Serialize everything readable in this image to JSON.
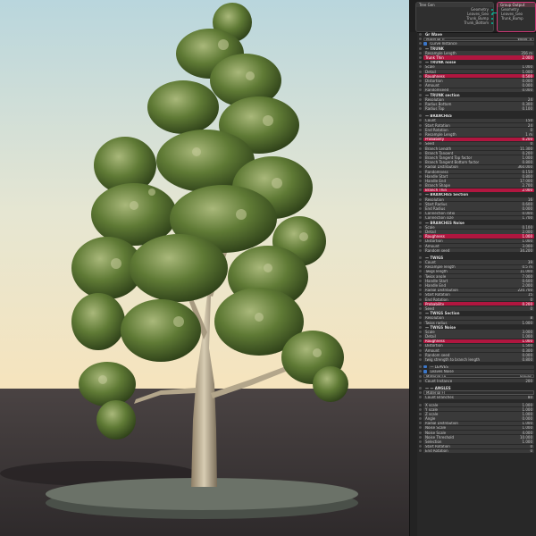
{
  "colors": {
    "accent": "#b0163f",
    "sky_top": "#bcd7dd",
    "sky_bottom": "#f4e6c5",
    "ground": "#3f3a39",
    "socket": "#00c0a0"
  },
  "node_editor": {
    "geometry_node": {
      "title": "Tree Gen",
      "rows": [
        "Geometry",
        "Leaves_Geo",
        "Trunk_Bump",
        "Trunk_Bottom"
      ]
    },
    "output_node": {
      "title": "Group Output",
      "rows": [
        "Geometry",
        "Leaves_Geo",
        "Trunk_Bump"
      ]
    }
  },
  "properties": [
    {
      "kind": "sec",
      "label": "Gr   Wave"
    },
    {
      "kind": "field",
      "label": "Material Tr",
      "value": "Wood_4"
    },
    {
      "kind": "check",
      "label": "Curve Instance"
    },
    {
      "kind": "sec",
      "label": "— TRUNK"
    },
    {
      "kind": "num",
      "label": "Resample Length",
      "value": "356 m"
    },
    {
      "kind": "hl",
      "label": "Trunk Thin",
      "value": "2.000"
    },
    {
      "kind": "sec",
      "label": "— TRUNK noise"
    },
    {
      "kind": "num",
      "label": "Scale",
      "value": "1.000"
    },
    {
      "kind": "num",
      "label": "Detail",
      "value": "1.000"
    },
    {
      "kind": "hl",
      "label": "Roughness",
      "value": "0.500"
    },
    {
      "kind": "num",
      "label": "Distortion",
      "value": "0.000"
    },
    {
      "kind": "num",
      "label": "Amount",
      "value": "0.000"
    },
    {
      "kind": "num",
      "label": "Randomseed",
      "value": "0.000"
    },
    {
      "kind": "sec",
      "label": "— TRUNK section"
    },
    {
      "kind": "num",
      "label": "Resolution",
      "value": "24"
    },
    {
      "kind": "num",
      "label": "Radius Bottom",
      "value": "0.300"
    },
    {
      "kind": "num",
      "label": "Radius Top",
      "value": "0.100"
    },
    {
      "kind": "gap"
    },
    {
      "kind": "sec",
      "label": "— BRANCHES"
    },
    {
      "kind": "num",
      "label": "Count",
      "value": "150"
    },
    {
      "kind": "num",
      "label": "Start Rotation",
      "value": "24"
    },
    {
      "kind": "num",
      "label": "End Rotation",
      "value": "0"
    },
    {
      "kind": "num",
      "label": "Resample Length",
      "value": "1 m"
    },
    {
      "kind": "hl",
      "label": "Probability",
      "value": "0.200"
    },
    {
      "kind": "num",
      "label": "Seed",
      "value": "0"
    },
    {
      "kind": "num",
      "label": "Branch Length",
      "value": "11.300"
    },
    {
      "kind": "num",
      "label": "Branch Tangent",
      "value": "0.200"
    },
    {
      "kind": "num",
      "label": "Branch Tangent Top factor",
      "value": "1.000"
    },
    {
      "kind": "num",
      "label": "Branch Tangent Bottom factor",
      "value": "0.800"
    },
    {
      "kind": "num",
      "label": "Radial Distribution",
      "value": "360.000"
    },
    {
      "kind": "num",
      "label": "Randomness",
      "value": "0.150"
    },
    {
      "kind": "num",
      "label": "Handle Start",
      "value": "0.800"
    },
    {
      "kind": "num",
      "label": "Handle End",
      "value": "17.000"
    },
    {
      "kind": "num",
      "label": "Branch Shape",
      "value": "2.700"
    },
    {
      "kind": "hl",
      "label": "Branch Thin",
      "value": "2.000"
    },
    {
      "kind": "sec",
      "label": "— BRANCHES Section"
    },
    {
      "kind": "num",
      "label": "Resolution",
      "value": "16"
    },
    {
      "kind": "num",
      "label": "Start Radius",
      "value": "0.600"
    },
    {
      "kind": "num",
      "label": "End Radius",
      "value": "0.000"
    },
    {
      "kind": "num",
      "label": "Connection ratio",
      "value": "0.000"
    },
    {
      "kind": "num",
      "label": "Connection size",
      "value": "1.700"
    },
    {
      "kind": "sec",
      "label": "— BRANCHES Noise"
    },
    {
      "kind": "num",
      "label": "Scale",
      "value": "0.100"
    },
    {
      "kind": "num",
      "label": "Detail",
      "value": "2.000"
    },
    {
      "kind": "hl",
      "label": "Roughness",
      "value": "1.000"
    },
    {
      "kind": "num",
      "label": "Distortion",
      "value": "1.000"
    },
    {
      "kind": "num",
      "label": "Amount",
      "value": "3.000"
    },
    {
      "kind": "num",
      "label": "Random seed",
      "value": "34.200"
    },
    {
      "kind": "gap"
    },
    {
      "kind": "sec",
      "label": "— TWIGS"
    },
    {
      "kind": "num",
      "label": "Count",
      "value": "39"
    },
    {
      "kind": "num",
      "label": "Resample length",
      "value": "0.5 m"
    },
    {
      "kind": "num",
      "label": "Twigs length",
      "value": "11.000"
    },
    {
      "kind": "num",
      "label": "Twigs angle",
      "value": "7.000"
    },
    {
      "kind": "num",
      "label": "Handle Start",
      "value": "0.600"
    },
    {
      "kind": "num",
      "label": "Handle End",
      "value": "2.000"
    },
    {
      "kind": "num",
      "label": "Radial Distribution",
      "value": "220.700"
    },
    {
      "kind": "num",
      "label": "Start Rotation",
      "value": "15"
    },
    {
      "kind": "num",
      "label": "End Rotation",
      "value": "0"
    },
    {
      "kind": "hl",
      "label": "Probability",
      "value": "0.200"
    },
    {
      "kind": "num",
      "label": "Seed",
      "value": "0"
    },
    {
      "kind": "sec",
      "label": "— TWIGS Section"
    },
    {
      "kind": "num",
      "label": "Resolution",
      "value": "8"
    },
    {
      "kind": "num",
      "label": "Twigs radius",
      "value": "1.000"
    },
    {
      "kind": "sec",
      "label": "— TWIGS Noise"
    },
    {
      "kind": "num",
      "label": "Scale",
      "value": "3.000"
    },
    {
      "kind": "num",
      "label": "Detail",
      "value": "1.000"
    },
    {
      "kind": "hl",
      "label": "Roughness",
      "value": "1.000"
    },
    {
      "kind": "num",
      "label": "Distortion",
      "value": "1.500"
    },
    {
      "kind": "num",
      "label": "Amount",
      "value": "0.300"
    },
    {
      "kind": "num",
      "label": "Random seed",
      "value": "0.000"
    },
    {
      "kind": "num",
      "label": "twig strength to branch length",
      "value": "0.800"
    },
    {
      "kind": "gap"
    },
    {
      "kind": "check",
      "label": "— LEAVES"
    },
    {
      "kind": "check",
      "label": "Leaves Noise"
    },
    {
      "kind": "field",
      "label": "Material Le",
      "value": "leaves"
    },
    {
      "kind": "num",
      "label": "Count Instance",
      "value": "200"
    },
    {
      "kind": "gap"
    },
    {
      "kind": "sec",
      "label": "— — ANGLES"
    },
    {
      "kind": "field",
      "label": "Material Fl",
      "value": ""
    },
    {
      "kind": "num",
      "label": "Count Branches",
      "value": "80"
    },
    {
      "kind": "gap"
    },
    {
      "kind": "num",
      "label": "X scale",
      "value": "1.000"
    },
    {
      "kind": "num",
      "label": "Y scale",
      "value": "1.000"
    },
    {
      "kind": "num",
      "label": "Z scale",
      "value": "1.000"
    },
    {
      "kind": "num",
      "label": "Angle",
      "value": "0.000"
    },
    {
      "kind": "num",
      "label": "Radial Distribution",
      "value": "1.000"
    },
    {
      "kind": "num",
      "label": "Noise Scale",
      "value": "1.000"
    },
    {
      "kind": "num",
      "label": "Noise Scale",
      "value": "4.000"
    },
    {
      "kind": "num",
      "label": "Noise Threshold",
      "value": "10.000"
    },
    {
      "kind": "num",
      "label": "Selection",
      "value": "1.000"
    },
    {
      "kind": "num",
      "label": "Start Rotation",
      "value": "0"
    },
    {
      "kind": "num",
      "label": "End Rotation",
      "value": "0"
    }
  ]
}
